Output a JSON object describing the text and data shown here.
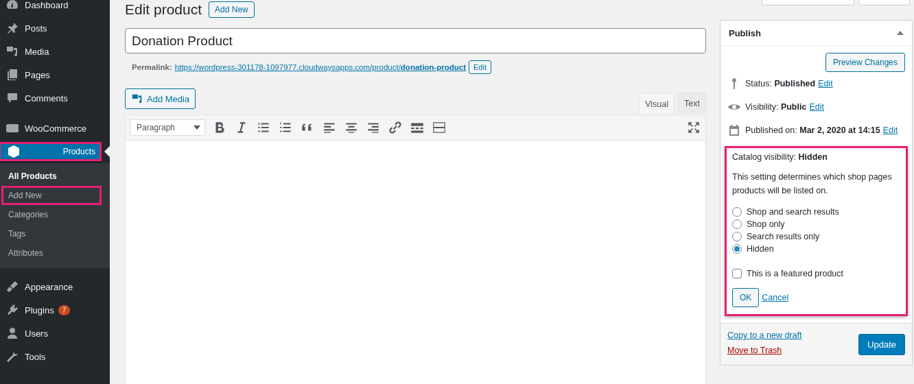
{
  "sidebar": {
    "groups": [
      {
        "items": [
          {
            "label": "Dashboard",
            "selected": false,
            "highlighted": false
          },
          {
            "label": "Posts",
            "selected": false,
            "highlighted": false
          },
          {
            "label": "Media",
            "selected": false,
            "highlighted": false
          },
          {
            "label": "Pages",
            "selected": false,
            "highlighted": false
          },
          {
            "label": "Comments",
            "selected": false,
            "highlighted": false
          }
        ]
      },
      {
        "items": [
          {
            "label": "WooCommerce",
            "selected": false,
            "highlighted": false
          },
          {
            "label": "Products",
            "selected": true,
            "highlighted": true,
            "children": [
              {
                "label": "All Products",
                "selected": true,
                "highlighted": false
              },
              {
                "label": "Add New",
                "selected": false,
                "highlighted": true
              },
              {
                "label": "Categories",
                "selected": false,
                "highlighted": false
              },
              {
                "label": "Tags",
                "selected": false,
                "highlighted": false
              },
              {
                "label": "Attributes",
                "selected": false,
                "highlighted": false
              }
            ]
          }
        ]
      },
      {
        "items": [
          {
            "label": "Appearance",
            "selected": false,
            "highlighted": false
          },
          {
            "label": "Plugins",
            "selected": false,
            "highlighted": false,
            "badge": "7"
          },
          {
            "label": "Users",
            "selected": false,
            "highlighted": false
          },
          {
            "label": "Tools",
            "selected": false,
            "highlighted": false
          }
        ]
      }
    ]
  },
  "header": {
    "title": "Edit product",
    "add_new": "Add New"
  },
  "title_field": {
    "value": "Donation Product"
  },
  "permalink": {
    "label": "Permalink:",
    "url_base": "https://wordpress-301178-1097977.cloudwaysapps.com/product/",
    "slug": "donation-product",
    "edit": "Edit"
  },
  "editor": {
    "add_media": "Add Media",
    "tabs": [
      {
        "label": "Visual",
        "selected": true
      },
      {
        "label": "Text",
        "selected": false
      }
    ],
    "format": "Paragraph"
  },
  "publish": {
    "title": "Publish",
    "preview": "Preview Changes",
    "rows": [
      {
        "text": "Status: **Published**",
        "edit": "Edit"
      },
      {
        "text": "Visibility: **Public**",
        "edit": "Edit"
      },
      {
        "text": "Published on: **Mar 2, 2020 at 14:15**",
        "edit": "Edit"
      }
    ],
    "catalog": {
      "highlighted": true,
      "heading": "Catalog visibility: **Hidden**",
      "description": "This setting determines which shop pages products will be listed on.",
      "options": [
        {
          "label": "Shop and search results",
          "selected": false
        },
        {
          "label": "Shop only",
          "selected": false
        },
        {
          "label": "Search results only",
          "selected": false
        },
        {
          "label": "Hidden",
          "selected": true
        }
      ],
      "featured": {
        "label": "This is a featured product",
        "checked": false
      },
      "ok": "OK",
      "cancel": "Cancel"
    },
    "copy": "Copy to a new draft",
    "trash": "Move to Trash",
    "update": "Update"
  }
}
